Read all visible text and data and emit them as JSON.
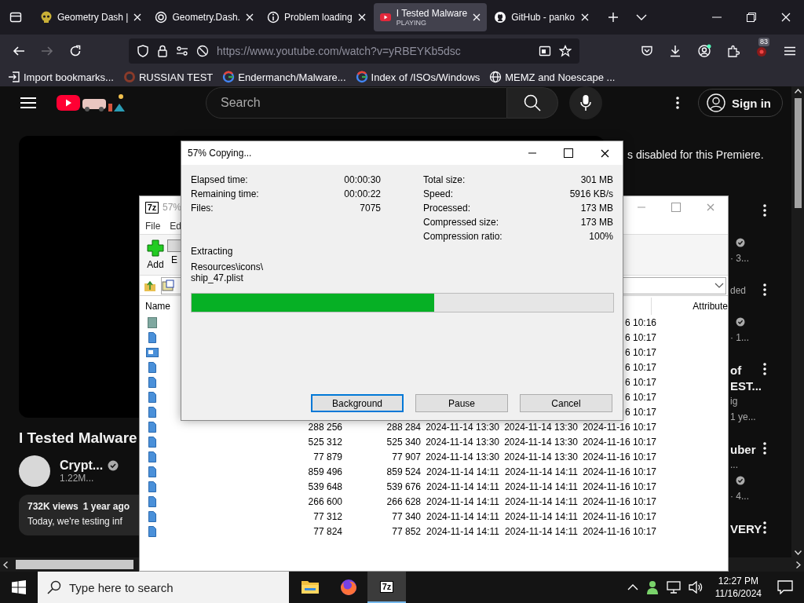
{
  "browser": {
    "tabs": [
      {
        "title": "Geometry Dash |",
        "selected": false
      },
      {
        "title": "Geometry.Dash.",
        "selected": false
      },
      {
        "title": "Problem loading",
        "selected": false
      },
      {
        "title": "I Tested Malware",
        "subtitle": "PLAYING",
        "selected": true
      },
      {
        "title": "GitHub - panko",
        "selected": false
      }
    ],
    "forward_disabled": true,
    "url": "https://www.youtube.com/watch?v=yRBEYKb5dsc",
    "extension_badge": "83",
    "bookmarks": [
      "Import bookmarks...",
      "RUSSIAN TEST",
      "Endermanch/Malware...",
      "Index of /ISOs/Windows",
      "MEMZ and Noescape ..."
    ]
  },
  "youtube": {
    "search_placeholder": "Search",
    "sign_in": "Sign in",
    "chat_notice": "s disabled for this Premiere.",
    "video_title": "I Tested Malware",
    "channel": "Crypt...",
    "channel_verified": true,
    "subscribers": "1.22M...",
    "views": "732K views",
    "age": "1 year ago",
    "description": "Today, we're testing inf",
    "recommended": [
      {
        "lines": [
          {
            "kind": "gap"
          },
          {
            "kind": "gap"
          },
          {
            "kind": "verified"
          },
          {
            "kind": "text",
            "text": "· 3..."
          }
        ]
      },
      {
        "lines": [
          {
            "kind": "text",
            "text": "ded"
          },
          {
            "kind": "gap"
          },
          {
            "kind": "verified"
          },
          {
            "kind": "text",
            "text": "· 1..."
          }
        ]
      },
      {
        "lines": [
          {
            "kind": "text",
            "text": "of",
            "bold": true
          },
          {
            "kind": "text",
            "text": "EST...",
            "bold": true
          },
          {
            "kind": "text",
            "text": "ig"
          },
          {
            "kind": "text",
            "text": "1 ye..."
          }
        ]
      },
      {
        "lines": [
          {
            "kind": "text",
            "text": "uber",
            "bold": true
          },
          {
            "kind": "text",
            "text": "..."
          },
          {
            "kind": "verified"
          },
          {
            "kind": "text",
            "text": "· 4..."
          }
        ]
      },
      {
        "lines": [
          {
            "kind": "text",
            "text": "VERY",
            "bold": true
          }
        ]
      }
    ]
  },
  "sevenzip": {
    "logo_text": "7z",
    "title": "57%",
    "menu": [
      "File",
      "Ed"
    ],
    "toolbar": [
      "Add",
      "E"
    ],
    "columns": [
      "Name",
      "Attribute"
    ],
    "rows": [
      {
        "accessed": "6 10:16"
      },
      {
        "accessed": "6 10:17"
      },
      {
        "accessed": "6 10:17"
      },
      {
        "accessed": "6 10:17"
      },
      {
        "accessed": "6 10:17"
      },
      {
        "accessed": "6 10:17"
      },
      {
        "accessed": "6 10:17"
      },
      {
        "size": "288 256",
        "packed": "288 284",
        "modified": "2024-11-14 13:30",
        "created": "2024-11-14 13:30",
        "accessed": "2024-11-16 10:17"
      },
      {
        "size": "525 312",
        "packed": "525 340",
        "modified": "2024-11-14 13:30",
        "created": "2024-11-14 13:30",
        "accessed": "2024-11-16 10:17"
      },
      {
        "size": "77 879",
        "packed": "77 907",
        "modified": "2024-11-14 13:30",
        "created": "2024-11-14 13:30",
        "accessed": "2024-11-16 10:17"
      },
      {
        "size": "859 496",
        "packed": "859 524",
        "modified": "2024-11-14 14:11",
        "created": "2024-11-14 14:11",
        "accessed": "2024-11-16 10:17"
      },
      {
        "size": "539 648",
        "packed": "539 676",
        "modified": "2024-11-14 14:11",
        "created": "2024-11-14 14:11",
        "accessed": "2024-11-16 10:17"
      },
      {
        "size": "266 600",
        "packed": "266 628",
        "modified": "2024-11-14 14:11",
        "created": "2024-11-14 14:11",
        "accessed": "2024-11-16 10:17"
      },
      {
        "size": "77 312",
        "packed": "77 340",
        "modified": "2024-11-14 14:11",
        "created": "2024-11-14 14:11",
        "accessed": "2024-11-16 10:17"
      },
      {
        "size": "77 824",
        "packed": "77 852",
        "modified": "2024-11-14 14:11",
        "created": "2024-11-14 14:11",
        "accessed": "2024-11-16 10:17"
      }
    ]
  },
  "dialog": {
    "title": "57% Copying...",
    "left_stats": [
      {
        "label": "Elapsed time:",
        "value": "00:00:30"
      },
      {
        "label": "Remaining time:",
        "value": "00:00:22"
      },
      {
        "label": "Files:",
        "value": "7075"
      }
    ],
    "right_stats": [
      {
        "label": "Total size:",
        "value": "301 MB"
      },
      {
        "label": "Speed:",
        "value": "5916 KB/s"
      },
      {
        "label": "Processed:",
        "value": "173 MB"
      },
      {
        "label": "Compressed size:",
        "value": "173 MB"
      },
      {
        "label": "Compression ratio:",
        "value": "100%"
      }
    ],
    "status": "Extracting",
    "current_file": [
      "Resources\\icons\\",
      "ship_47.plist"
    ],
    "progress": {
      "level": 0.575
    },
    "buttons": [
      {
        "label": "Background",
        "focused": true
      },
      {
        "label": "Pause",
        "focused": false
      },
      {
        "label": "Cancel",
        "focused": false
      }
    ]
  },
  "taskbar": {
    "search_placeholder": "Type here to search",
    "apps": [
      {
        "selected": false
      },
      {
        "selected": false
      },
      {
        "selected": true,
        "logo_text": "7z"
      }
    ],
    "time": "12:27 PM",
    "date": "11/16/2024"
  }
}
